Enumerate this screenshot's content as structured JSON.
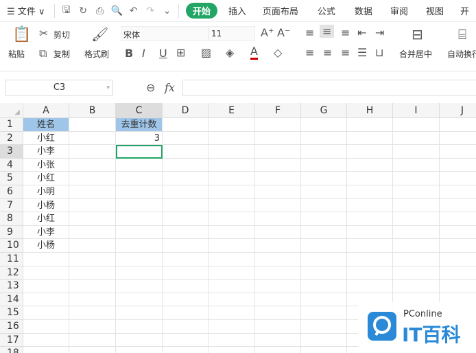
{
  "menu": {
    "file": "文件",
    "tabs": [
      "开始",
      "插入",
      "页面布局",
      "公式",
      "数据",
      "审阅",
      "视图",
      "开"
    ]
  },
  "ribbon": {
    "paste": "粘贴",
    "cut": "剪切",
    "copy": "复制",
    "format_painter": "格式刷",
    "font": "宋体",
    "size": "11",
    "merge": "合并居中",
    "wrap": "自动换行"
  },
  "formula_bar": {
    "name_box": "C3",
    "fx": "fx",
    "value": ""
  },
  "columns": [
    "A",
    "B",
    "C",
    "D",
    "E",
    "F",
    "G",
    "H",
    "I",
    "J"
  ],
  "rows": [
    "1",
    "2",
    "3",
    "4",
    "5",
    "6",
    "7",
    "8",
    "9",
    "10",
    "11",
    "12",
    "13",
    "14",
    "15",
    "16",
    "17"
  ],
  "cells": {
    "A": [
      "姓名",
      "小红",
      "小李",
      "小张",
      "小红",
      "小明",
      "小杨",
      "小红",
      "小李",
      "小杨"
    ],
    "C1": "去重计数",
    "C2": "3"
  },
  "selected": "C3",
  "watermark": {
    "brand": "PConline",
    "sub": "IT百科"
  },
  "colors": {
    "accent": "#22a565",
    "header_fill": "#9fc5e8"
  }
}
